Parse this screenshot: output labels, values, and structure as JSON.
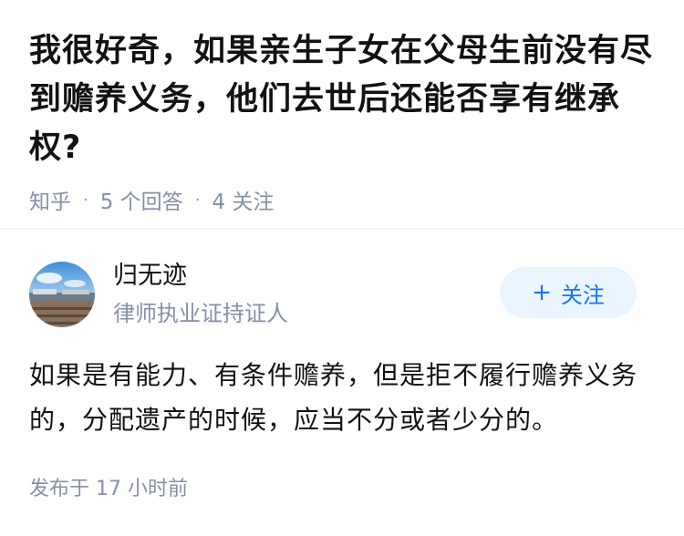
{
  "question": {
    "title": "我很好奇，如果亲生子女在父母生前没有尽到赡养义务，他们去世后还能否享有继承权?",
    "source": "知乎",
    "answers_count": "5 个回答",
    "follows_count": "4 关注"
  },
  "answer": {
    "author_name": "归无迹",
    "author_badge": "律师执业证持证人",
    "follow_label": "关注",
    "follow_plus": "+",
    "content": "如果是有能力、有条件赡养，但是拒不履行赡养义务的，分配遗产的时候，应当不分或者少分的。",
    "time": "发布于  17 小时前"
  },
  "colors": {
    "accent": "#1772f6",
    "follow_bg": "#ebf5ff",
    "meta_gray": "#8590a6"
  }
}
